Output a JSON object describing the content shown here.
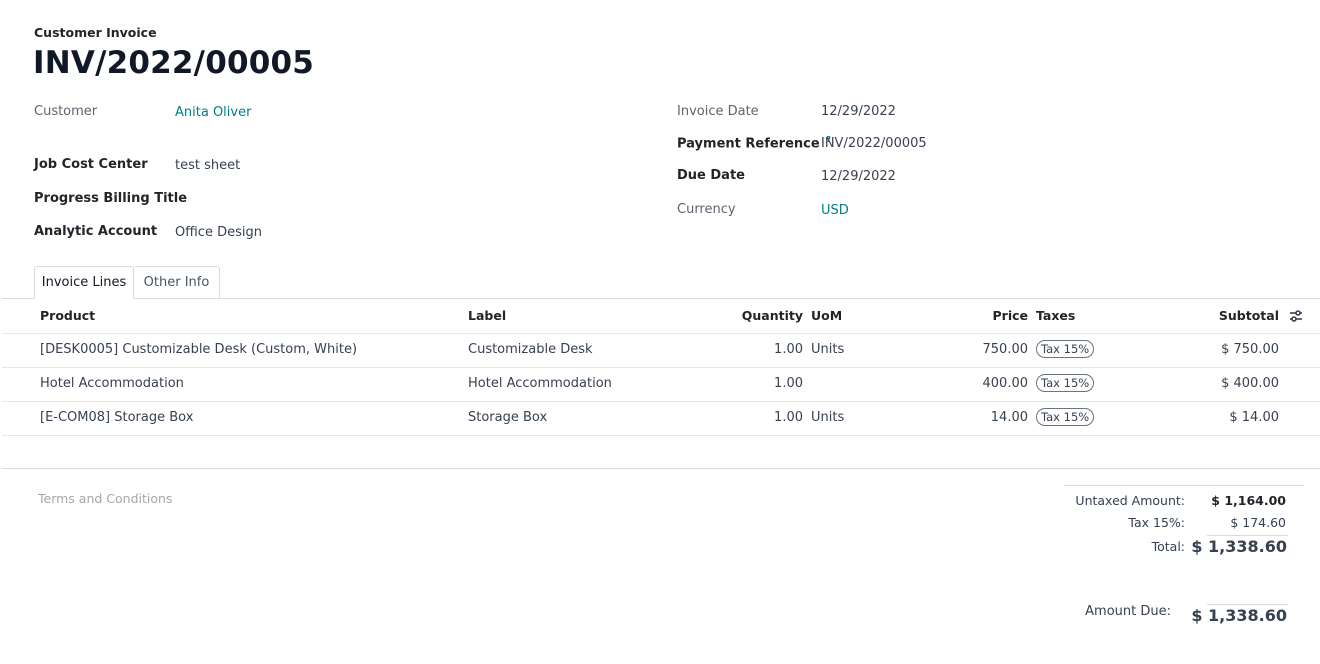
{
  "header": {
    "doc_type": "Customer Invoice",
    "title": "INV/2022/00005"
  },
  "left_fields": {
    "customer_label": "Customer",
    "customer_value": "Anita Oliver",
    "job_cost_center_label": "Job Cost Center",
    "job_cost_center_value": "test sheet",
    "progress_billing_title_label": "Progress Billing Title",
    "progress_billing_title_value": "",
    "analytic_account_label": "Analytic Account",
    "analytic_account_value": "Office Design"
  },
  "right_fields": {
    "invoice_date_label": "Invoice Date",
    "invoice_date_value": "12/29/2022",
    "payment_reference_label": "Payment Reference",
    "payment_reference_help": "?",
    "payment_reference_value": "INV/2022/00005",
    "due_date_label": "Due Date",
    "due_date_value": "12/29/2022",
    "currency_label": "Currency",
    "currency_value": "USD"
  },
  "tabs": [
    {
      "label": "Invoice Lines",
      "active": true
    },
    {
      "label": "Other Info",
      "active": false
    }
  ],
  "table": {
    "columns": {
      "product": "Product",
      "label": "Label",
      "quantity": "Quantity",
      "uom": "UoM",
      "price": "Price",
      "taxes": "Taxes",
      "subtotal": "Subtotal"
    },
    "settings_icon": "sliders-icon",
    "rows": [
      {
        "product": "[DESK0005] Customizable Desk (Custom, White)",
        "label": "Customizable Desk",
        "quantity": "1.00",
        "uom": "Units",
        "price": "750.00",
        "tax": "Tax 15%",
        "subtotal": "$ 750.00"
      },
      {
        "product": "Hotel Accommodation",
        "label": "Hotel Accommodation",
        "quantity": "1.00",
        "uom": "",
        "price": "400.00",
        "tax": "Tax 15%",
        "subtotal": "$ 400.00"
      },
      {
        "product": "[E-COM08] Storage Box",
        "label": "Storage Box",
        "quantity": "1.00",
        "uom": "Units",
        "price": "14.00",
        "tax": "Tax 15%",
        "subtotal": "$ 14.00"
      }
    ]
  },
  "terms_placeholder": "Terms and Conditions",
  "totals": {
    "untaxed_label": "Untaxed Amount:",
    "untaxed_value": "$ 1,164.00",
    "tax_label": "Tax 15%:",
    "tax_value": "$ 174.60",
    "total_label": "Total:",
    "total_value": "$ 1,338.60",
    "amount_due_label": "Amount Due:",
    "amount_due_value": "$ 1,338.60"
  },
  "colors": {
    "link": "#017e84",
    "text": "#374151",
    "border": "#d8dadd"
  }
}
